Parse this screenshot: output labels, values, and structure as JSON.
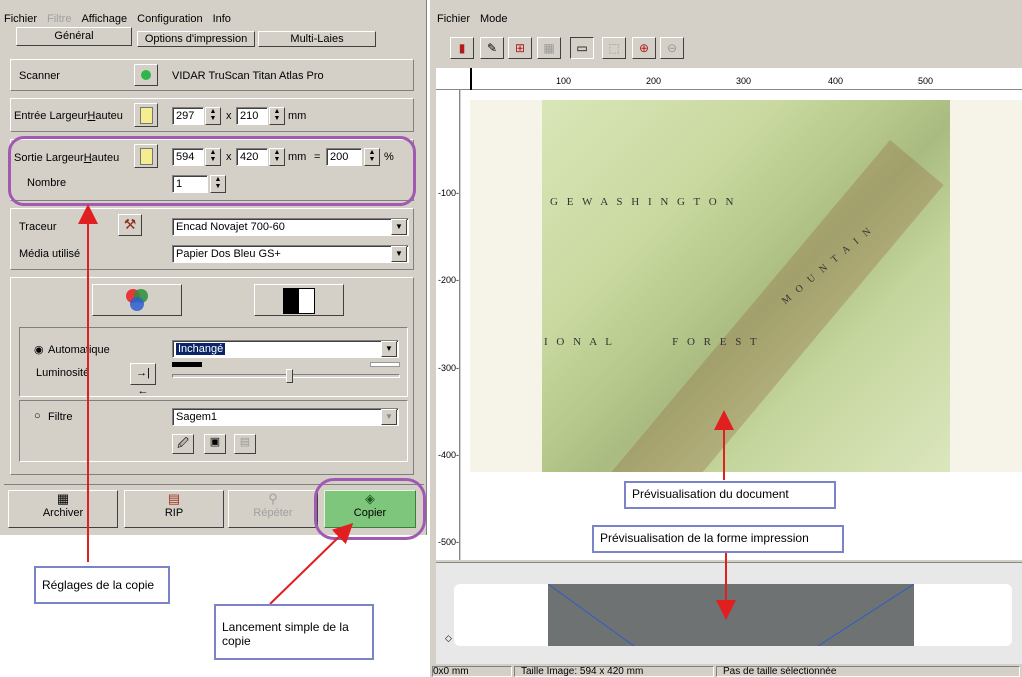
{
  "left_menu": {
    "fichier": "Fichier",
    "filtre": "Filtre",
    "affichage": "Affichage",
    "configuration": "Configuration",
    "info": "Info"
  },
  "tabs": {
    "general": "Général",
    "options": "Options d'impression",
    "multi": "Multi-Laies"
  },
  "scanner": {
    "label": "Scanner",
    "value": "VIDAR TruScan Titan Atlas Pro"
  },
  "entree": {
    "label_prefix": "Entrée Largeur",
    "label_u": "H",
    "label_suffix": "auteu",
    "width": "297",
    "height": "210",
    "unit": "mm",
    "x": "x"
  },
  "sortie": {
    "label_prefix": "Sortie Largeur",
    "label_u": "H",
    "label_suffix": "auteu",
    "width": "594",
    "height": "420",
    "unit": "mm",
    "equals": "=",
    "percent": "200",
    "pct_sign": "%",
    "x": "x"
  },
  "nombre": {
    "label": "Nombre",
    "value": "1"
  },
  "traceur": {
    "label": "Traceur",
    "value": "Encad Novajet 700-60"
  },
  "media": {
    "label": "Média utilisé",
    "value": "Papier Dos Bleu GS+"
  },
  "auto": {
    "label": "Automatique",
    "value": "Inchangé",
    "luminosite": "Luminosité"
  },
  "filtre": {
    "label": "Filtre",
    "value": "Sagem1"
  },
  "actions": {
    "archiver": "Archiver",
    "rip": "RIP",
    "repeter": "Répéter",
    "copier": "Copier"
  },
  "right_menu": {
    "fichier": "Fichier",
    "mode": "Mode"
  },
  "ruler_top": [
    "100",
    "200",
    "300",
    "400",
    "500"
  ],
  "ruler_left": [
    "-100-",
    "-200-",
    "-300-",
    "-400-",
    "-500-"
  ],
  "map_labels": {
    "washington": "G E   W A S H I N G T O N",
    "forest": "I O N A L          F O R E S T",
    "mountain": "M O U N T A I N"
  },
  "status": {
    "pos": "0x0 mm",
    "size": "Taille Image: 594 x 420 mm",
    "msg": "Pas de taille sélectionnée"
  },
  "callouts": {
    "doc": "Prévisualisation du document",
    "forme": "Prévisualisation de la forme impression",
    "reglages": "Réglages de la copie",
    "lancement": "Lancement simple de la copie"
  },
  "colors": {
    "accent_green": "#7ec67b",
    "highlight_purple": "#a05ab3",
    "callout_border": "#7b83c9",
    "arrow_red": "#e02020",
    "selection_blue": "#0a246a"
  }
}
